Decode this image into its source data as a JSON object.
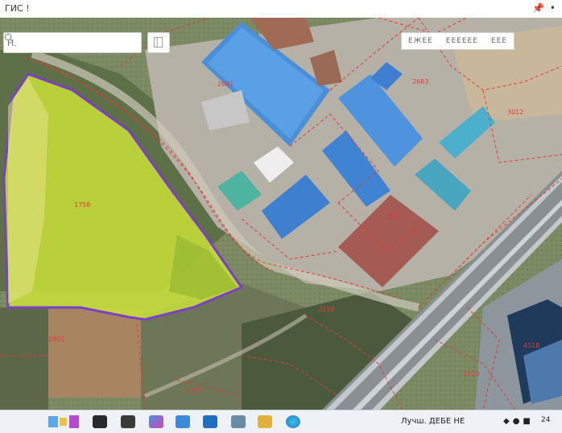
{
  "window": {
    "title": "ГИС !",
    "pin_icon": "pin-icon",
    "status_icon": "status-dot-icon"
  },
  "search": {
    "placeholder": "Н.",
    "value": ""
  },
  "layer_tabs": [
    "ЕЖЕЕ",
    "ЕЕЕЕЕЕ",
    "ЕЕЕ"
  ],
  "parcel_labels": [
    "1758",
    "2681",
    "2683",
    "3021",
    "3012",
    "2801",
    "3315",
    "4318",
    "1810",
    "2218"
  ],
  "taskbar": {
    "icons": [
      "widgets-icon",
      "start-icon",
      "search-icon",
      "copilot-icon",
      "store-icon",
      "mail-icon",
      "files-icon",
      "folder-icon",
      "edge-icon"
    ],
    "tray_text": "Лучш. ДЕБЕ НЕ",
    "clock": "24"
  },
  "colors": {
    "highlight_fill": "#c9e03a",
    "highlight_outline": "#7d3fc8",
    "parcel_line": "#e23a3a"
  }
}
